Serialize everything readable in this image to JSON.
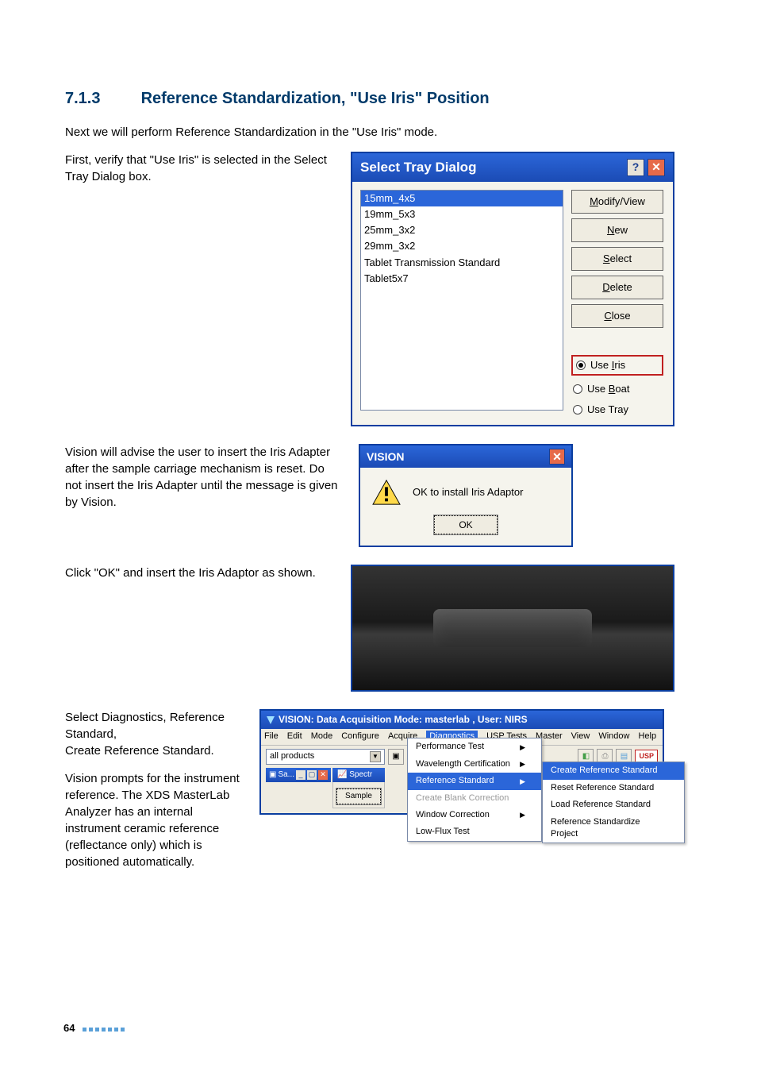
{
  "heading": {
    "number": "7.1.3",
    "title": "Reference Standardization, \"Use Iris\" Position"
  },
  "para_intro": "Next we will perform Reference Standardization in the \"Use Iris\" mode.",
  "para_first": "First, verify that \"Use Iris\" is selected in the Select Tray Dialog box.",
  "select_tray": {
    "title": "Select Tray Dialog",
    "items": [
      "15mm_4x5",
      "19mm_5x3",
      "25mm_3x2",
      "29mm_3x2",
      "Tablet Transmission Standard",
      "Tablet5x7"
    ],
    "selected_index": 0,
    "buttons": {
      "modify": "Modify/View",
      "new": "New",
      "select": "Select",
      "delete": "Delete",
      "close": "Close"
    },
    "radios": {
      "iris": "Use Iris",
      "boat": "Use Boat",
      "tray": "Use Tray",
      "selected": "iris"
    }
  },
  "para_insert": "Vision will advise the user to insert the Iris Adapter after the sample carriage mechanism is reset. Do not insert the Iris Adapter until the message is given by Vision.",
  "msgbox": {
    "title": "VISION",
    "text": "OK to install Iris Adaptor",
    "ok": "OK"
  },
  "para_ok": "Click \"OK\" and insert the Iris Adaptor as shown.",
  "para_diag1": "Select Diagnostics, Reference Standard,",
  "para_diag2": "Create Reference Standard.",
  "para_prompt": "Vision prompts for the instrument reference. The XDS MasterLab Analyzer has an internal instrument ceramic reference (reflectance only) which is positioned automatically.",
  "app": {
    "title": "VISION: Data Acquisition Mode: masterlab , User: NIRS",
    "menubar": [
      "File",
      "Edit",
      "Mode",
      "Configure",
      "Acquire",
      "Diagnostics",
      "USP Tests",
      "Master",
      "View",
      "Window",
      "Help"
    ],
    "active_menu": "Diagnostics",
    "combo_value": "all products",
    "mini_window": "Sa...",
    "mini_window2": "Spectr",
    "sample_button": "Sample",
    "diag_menu": [
      {
        "label": "Performance Test",
        "sub": true
      },
      {
        "label": "Wavelength Certification",
        "sub": true
      },
      {
        "label": "Reference Standard",
        "sub": true,
        "hl": true
      },
      {
        "label": "Create Blank Correction",
        "disabled": true
      },
      {
        "label": "Window Correction",
        "sub": true
      },
      {
        "label": "Low-Flux Test"
      }
    ],
    "ref_submenu": [
      {
        "label": "Create Reference Standard",
        "hl": true
      },
      {
        "label": "Reset Reference Standard"
      },
      {
        "label": "Load Reference Standard"
      },
      {
        "label": "Reference Standardize Project"
      }
    ],
    "usp_label": "USP"
  },
  "page_number": "64"
}
